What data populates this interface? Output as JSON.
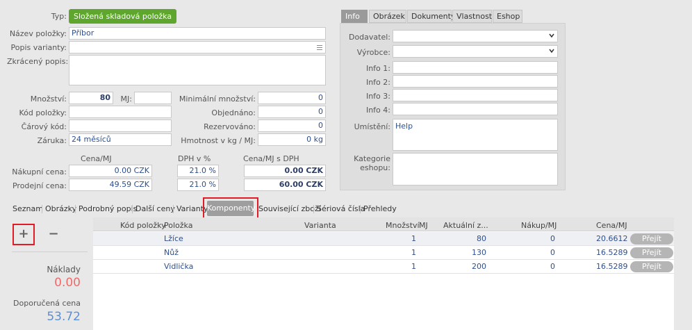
{
  "form": {
    "type_label": "Typ:",
    "type_value": "Složená skladová položka",
    "name_label": "Název položky:",
    "name_value": "Příbor",
    "variant_desc_label": "Popis varianty:",
    "variant_desc_value": "",
    "short_desc_label": "Zkrácený popis:",
    "short_desc_value": "",
    "quantity_label": "Množství:",
    "quantity_value": "80",
    "mj_label": "MJ:",
    "mj_value": "",
    "code_label": "Kód položky:",
    "code_value": "",
    "barcode_label": "Čárový kód:",
    "barcode_value": "",
    "warranty_label": "Záruka:",
    "warranty_value": "24 měsíců",
    "min_qty_label": "Minimální množství:",
    "min_qty_value": "0",
    "ordered_label": "Objednáno:",
    "ordered_value": "0",
    "reserved_label": "Rezervováno:",
    "reserved_value": "0",
    "weight_label": "Hmotnost v kg / MJ:",
    "weight_value": "0 kg",
    "price_header": "Cena/MJ",
    "vat_header": "DPH v %",
    "price_vat_header": "Cena/MJ s DPH",
    "purchase_label": "Nákupní cena:",
    "purchase_price": "0.00 CZK",
    "purchase_vat": "21.0 %",
    "purchase_price_vat": "0.00 CZK",
    "sale_label": "Prodejní cena:",
    "sale_price": "49.59 CZK",
    "sale_vat": "21.0 %",
    "sale_price_vat": "60.00 CZK"
  },
  "right_tabs": [
    "Info",
    "Obrázek",
    "Dokumenty",
    "Vlastnosti",
    "Eshop"
  ],
  "info": {
    "supplier_label": "Dodavatel:",
    "supplier_value": "",
    "manufacturer_label": "Výrobce:",
    "manufacturer_value": "",
    "info1_label": "Info 1:",
    "info2_label": "Info 2:",
    "info3_label": "Info 3:",
    "info4_label": "Info 4:",
    "location_label": "Umístění:",
    "location_value": "Help",
    "eshop_cat_label": "Kategorie eshopu:"
  },
  "bottom_tabs": [
    "Seznam",
    "Obrázky",
    "Podrobný popis",
    "Další ceny",
    "Varianty",
    "Komponenty",
    "Související zboží",
    "Sériová čísla",
    "Přehledy"
  ],
  "side": {
    "add_symbol": "+",
    "remove_symbol": "−",
    "costs_label": "Náklady",
    "costs_value": "0.00",
    "recommended_label": "Doporučená cena",
    "recommended_value": "53.72"
  },
  "table": {
    "headers": {
      "code": "Kód položky",
      "item": "Položka",
      "variant": "Varianta",
      "qty": "Množství",
      "mj": "MJ",
      "current": "Aktuální z...",
      "purchase": "Nákup/MJ",
      "price": "Cena/MJ"
    },
    "rows": [
      {
        "item": "Lžíce",
        "qty": "1",
        "current": "80",
        "purchase": "0",
        "price": "20.6612",
        "action": "Přejít"
      },
      {
        "item": "Nůž",
        "qty": "1",
        "current": "130",
        "purchase": "0",
        "price": "16.5289",
        "action": "Přejít"
      },
      {
        "item": "Vidlička",
        "qty": "1",
        "current": "200",
        "purchase": "0",
        "price": "16.5289",
        "action": "Přejít"
      }
    ]
  },
  "colors": {
    "type_badge": "#5ea62e",
    "highlight_box": "#e01b24",
    "costs_value": "#f06a6a",
    "recommended_value": "#5a8fd8"
  }
}
